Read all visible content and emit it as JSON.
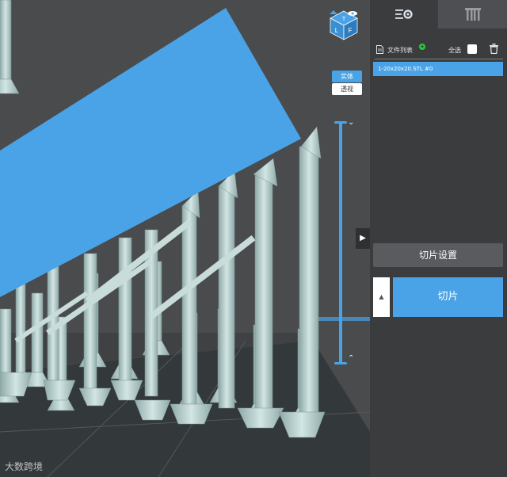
{
  "viewport": {
    "view_modes": [
      {
        "label": "实体"
      },
      {
        "label": "透视"
      }
    ],
    "view_cube_faces": {
      "top": "T",
      "left": "L",
      "front": "F"
    },
    "watermark": "大数跨境"
  },
  "panel": {
    "tabs": [
      {
        "name": "settings",
        "icon": "settings-icon"
      },
      {
        "name": "support",
        "icon": "support-icon"
      }
    ],
    "file_list": {
      "title": "文件列表",
      "select_all": "全选",
      "items": [
        {
          "label": "1-20x20x20.STL #0"
        }
      ]
    },
    "slice_settings_label": "切片设置",
    "slice_option_glyph": "▲",
    "slice_label": "切片"
  },
  "colors": {
    "accent": "#4aa3e6",
    "panel_bg": "#3b3c3e",
    "viewport_bg": "#4a4b4d",
    "support": "#b8d4d2"
  }
}
